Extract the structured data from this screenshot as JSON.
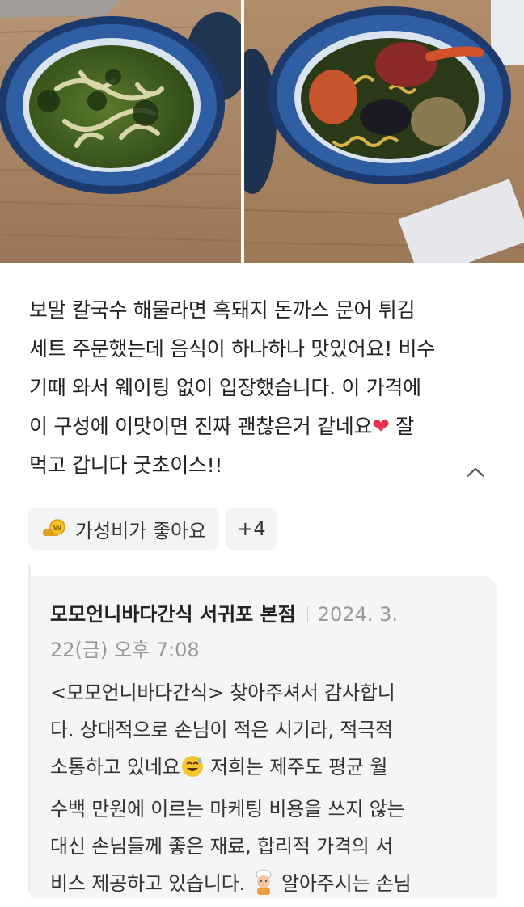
{
  "photos": [
    {
      "alt": "보말 칼국수"
    },
    {
      "alt": "해물라면"
    }
  ],
  "review": {
    "lines": [
      "보말 칼국수 해물라면 흑돼지 돈까스 문어 튀김",
      "세트 주문했는데 음식이 하나하나 맛있어요! 비수",
      "기때 와서 웨이팅 없이 입장했습니다. 이 가격에",
      "이 구성에 이맛이면 진짜 괜찮은거 같네요",
      "잘",
      "먹고 갑니다 굿초이스!!"
    ],
    "heart": "❤"
  },
  "tags": {
    "first": "가성비가 좋아요",
    "more": "+4"
  },
  "reply": {
    "owner": "모모언니바다간식 서귀포 본점",
    "date_part1": "2024. 3.",
    "date_part2": "22(금) 오후 7:08",
    "body": [
      "<모모언니바다간식> 찾아주셔서 감사합니",
      "다. 상대적으로 손님이 적은 시기라, 적극적",
      "소통하고 있네요",
      "저희는 제주도 평균 월",
      "수백 만원에 이르는 마케팅 비용을 쓰지 않는",
      "대신 손님들께 좋은 재료, 합리적 가격의 서",
      "비스 제공하고 있습니다.",
      "알아주시는 손님"
    ]
  },
  "colors": {
    "heart": "#e8304f",
    "tag_bg": "#f3f4f6",
    "reply_bg": "#f4f5f7"
  }
}
